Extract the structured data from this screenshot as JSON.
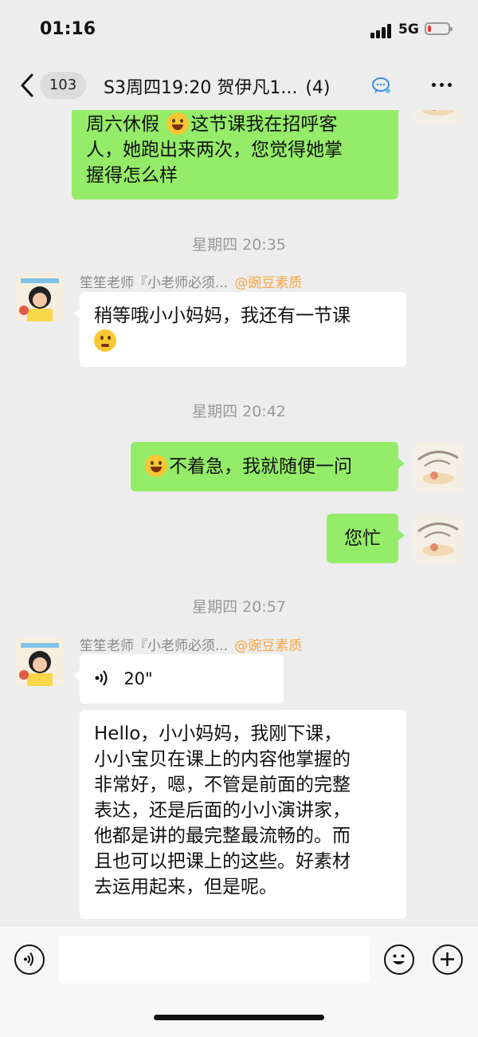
{
  "status": {
    "time": "01:16",
    "network": "5G"
  },
  "nav": {
    "back_icon": "chevron-left-icon",
    "unread_badge": "103",
    "title": "S3周四19:20 贺伊凡1...",
    "member_count": "(4)",
    "chat_icon": "speech-bubble-icon",
    "more_icon": "more-dots-icon"
  },
  "messages": {
    "m1": {
      "line1_pre": "周六休假 ",
      "line1_post": "这节课我在招呼客",
      "line2": "人，她跑出来两次，您觉得她掌",
      "line3": "握得怎么样",
      "emoji": "laughing-emoji-icon"
    },
    "ts1": "星期四 20:35",
    "m2": {
      "sender": "笙笙老师『小老师必须...",
      "org": "@豌豆素质",
      "line1": "稍等哦小小妈妈，我还有一节课",
      "emoji": "thinking-emoji-icon"
    },
    "ts2": "星期四 20:42",
    "m3": {
      "text": "不着急，我就随便一问",
      "emoji": "grinning-emoji-icon"
    },
    "m4": {
      "text": "您忙"
    },
    "ts3": "星期四 20:57",
    "m5": {
      "sender": "笙笙老师『小老师必须...",
      "org": "@豌豆素质",
      "voice_duration": "20\""
    },
    "m6": {
      "lines": [
        "Hello，小小妈妈，我刚下课，",
        "小小宝贝在课上的内容他掌握的",
        "非常好，嗯，不管是前面的完整",
        "表达，还是后面的小小演讲家，",
        "他都是讲的最完整最流畅的。而",
        "且也可以把课上的这些。好素材",
        "去运用起来，但是呢。"
      ]
    }
  },
  "input": {
    "voice_icon": "voice-input-icon",
    "emoji_icon": "emoji-icon",
    "plus_icon": "plus-icon"
  },
  "colors": {
    "sent_bubble": "#95ec69",
    "received_bubble": "#ffffff",
    "background": "#ededed",
    "org_tag": "#f7a646"
  }
}
